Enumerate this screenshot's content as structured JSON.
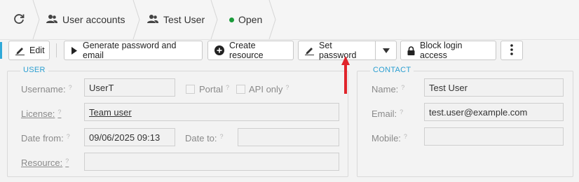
{
  "breadcrumb": {
    "refresh_icon": "refresh-icon",
    "items": [
      {
        "label": "User accounts",
        "icon": "users-icon"
      },
      {
        "label": "Test User",
        "icon": "user-icon"
      },
      {
        "label": "Open",
        "status_color": "#1a9b3a"
      }
    ]
  },
  "toolbar": {
    "edit": "Edit",
    "generate": "Generate password and email",
    "create_resource": "Create resource",
    "set_password": "Set password",
    "block_login": "Block login access"
  },
  "user_section": {
    "legend": "USER",
    "username_label": "Username:",
    "username_value": "UserT",
    "portal_label": "Portal",
    "api_only_label": "API only",
    "license_label": "License:",
    "license_value": "Team user",
    "date_from_label": "Date from:",
    "date_from_value": "09/06/2025 09:13",
    "date_to_label": "Date to:",
    "date_to_value": "",
    "resource_label": "Resource:",
    "resource_value": "",
    "help_mark": "?"
  },
  "contact_section": {
    "legend": "CONTACT",
    "name_label": "Name:",
    "name_value": "Test User",
    "email_label": "Email:",
    "email_value": "test.user@example.com",
    "mobile_label": "Mobile:",
    "mobile_value": ""
  },
  "colors": {
    "accent": "#2b9fd1",
    "arrow": "#e0242b"
  }
}
